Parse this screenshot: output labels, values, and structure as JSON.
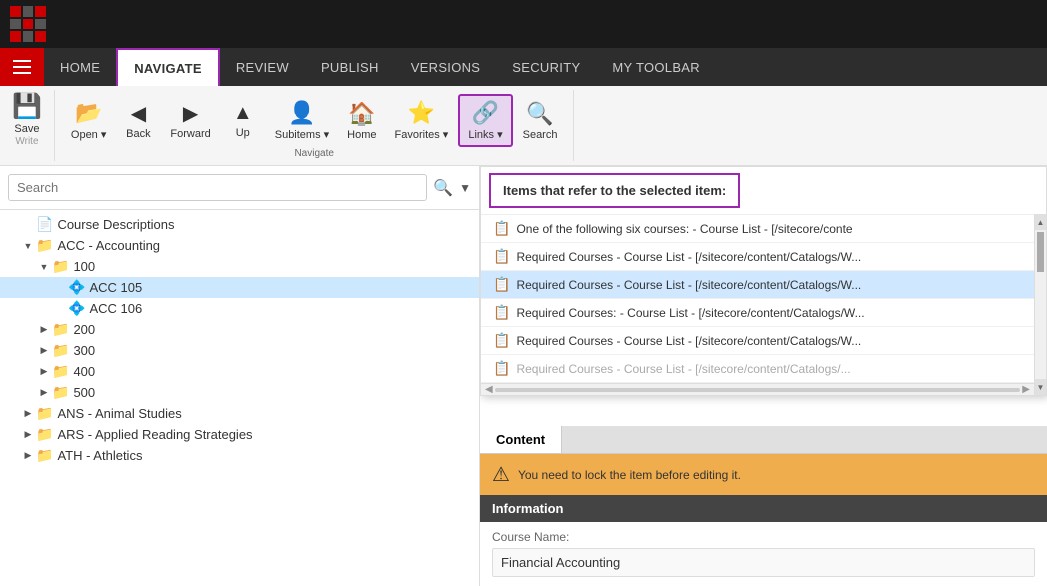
{
  "appLogo": "grid-logo",
  "topBar": {
    "bgColor": "#1a1a1a"
  },
  "navBar": {
    "items": [
      {
        "id": "home",
        "label": "HOME",
        "active": false
      },
      {
        "id": "navigate",
        "label": "NAVIGATE",
        "active": true
      },
      {
        "id": "review",
        "label": "REVIEW",
        "active": false
      },
      {
        "id": "publish",
        "label": "PUBLISH",
        "active": false
      },
      {
        "id": "versions",
        "label": "VERSIONS",
        "active": false
      },
      {
        "id": "security",
        "label": "SECURITY",
        "active": false
      },
      {
        "id": "mytoolbar",
        "label": "MY TOOLBAR",
        "active": false
      }
    ]
  },
  "ribbon": {
    "write_section": "Write",
    "navigate_section": "Navigate",
    "save_label": "Save",
    "open_label": "Open",
    "back_label": "Back",
    "forward_label": "Forward",
    "up_label": "Up",
    "subitems_label": "Subitems",
    "home_label": "Home",
    "favorites_label": "Favorites",
    "links_label": "Links",
    "search_label": "Search"
  },
  "search": {
    "placeholder": "Search",
    "value": ""
  },
  "tree": {
    "items": [
      {
        "id": "course-desc",
        "label": "Course Descriptions",
        "level": 1,
        "icon": "📄",
        "toggle": "",
        "selected": false
      },
      {
        "id": "acc",
        "label": "ACC - Accounting",
        "level": 1,
        "icon": "📁",
        "toggle": "▼",
        "selected": false
      },
      {
        "id": "acc-100",
        "label": "100",
        "level": 2,
        "icon": "📁",
        "toggle": "▼",
        "selected": false
      },
      {
        "id": "acc-105",
        "label": "ACC 105",
        "level": 3,
        "icon": "💎",
        "toggle": "",
        "selected": true
      },
      {
        "id": "acc-106",
        "label": "ACC 106",
        "level": 3,
        "icon": "💎",
        "toggle": "",
        "selected": false
      },
      {
        "id": "acc-200",
        "label": "200",
        "level": 2,
        "icon": "📁",
        "toggle": "▶",
        "selected": false
      },
      {
        "id": "acc-300",
        "label": "300",
        "level": 2,
        "icon": "📁",
        "toggle": "▶",
        "selected": false
      },
      {
        "id": "acc-400",
        "label": "400",
        "level": 2,
        "icon": "📁",
        "toggle": "▶",
        "selected": false
      },
      {
        "id": "acc-500",
        "label": "500",
        "level": 2,
        "icon": "📁",
        "toggle": "▶",
        "selected": false
      },
      {
        "id": "ans",
        "label": "ANS - Animal Studies",
        "level": 1,
        "icon": "📁",
        "toggle": "▶",
        "selected": false
      },
      {
        "id": "ars",
        "label": "ARS - Applied Reading Strategies",
        "level": 1,
        "icon": "📁",
        "toggle": "▶",
        "selected": false
      },
      {
        "id": "ath",
        "label": "ATH - Athletics",
        "level": 1,
        "icon": "📁",
        "toggle": "▶",
        "selected": false
      }
    ]
  },
  "linksPopup": {
    "title": "Items that refer to the selected item:",
    "items": [
      {
        "id": "link1",
        "text": "One of the following six courses: - Course List - [/sitecore/conte"
      },
      {
        "id": "link2",
        "text": "Required Courses - Course List - [/sitecore/content/Catalogs/W..."
      },
      {
        "id": "link3",
        "text": "Required Courses - Course List - [/sitecore/content/Catalogs/W..."
      },
      {
        "id": "link4",
        "text": "Required Courses: - Course List - [/sitecore/content/Catalogs/W..."
      },
      {
        "id": "link5",
        "text": "Required Courses - Course List - [/sitecore/content/Catalogs/W..."
      },
      {
        "id": "link6",
        "text": "Required Courses - Course List - [/sitecore/content/Catalogs/..."
      }
    ]
  },
  "content": {
    "tab_content": "Content",
    "warningText": "You need to lock the item before editing it.",
    "infoHeader": "Information",
    "courseNameLabel": "Course Name:",
    "courseNameValue": "Financial Accounting"
  }
}
